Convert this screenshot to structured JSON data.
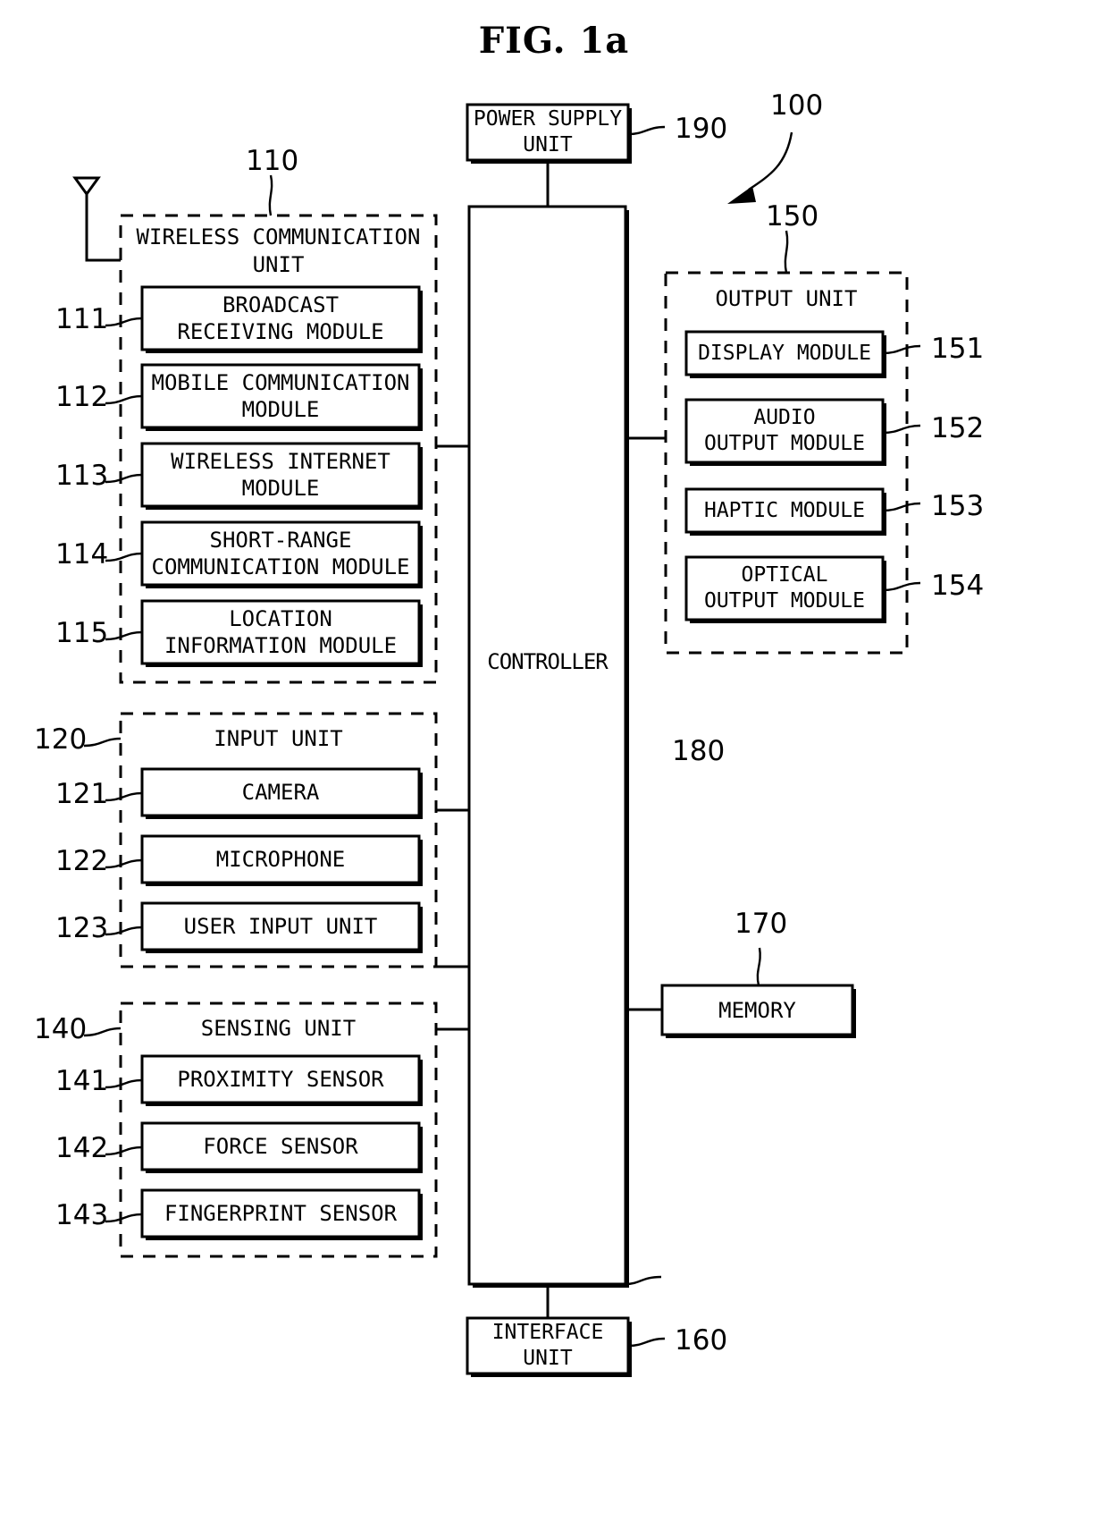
{
  "figure": {
    "title": "FIG. 1a",
    "device_ref": "100"
  },
  "power_supply": {
    "label": "POWER SUPPLY\nUNIT",
    "ref": "190"
  },
  "controller": {
    "label": "CONTROLLER",
    "ref": "180"
  },
  "interface": {
    "label": "INTERFACE\nUNIT",
    "ref": "160"
  },
  "memory": {
    "label": "MEMORY",
    "ref": "170"
  },
  "wireless_unit": {
    "title": "WIRELESS COMMUNICATION\nUNIT",
    "ref": "110",
    "modules": [
      {
        "label": "BROADCAST\nRECEIVING MODULE",
        "ref": "111"
      },
      {
        "label": "MOBILE COMMUNICATION\nMODULE",
        "ref": "112"
      },
      {
        "label": "WIRELESS INTERNET\nMODULE",
        "ref": "113"
      },
      {
        "label": "SHORT-RANGE\nCOMMUNICATION MODULE",
        "ref": "114"
      },
      {
        "label": "LOCATION\nINFORMATION MODULE",
        "ref": "115"
      }
    ]
  },
  "input_unit": {
    "title": "INPUT UNIT",
    "ref": "120",
    "modules": [
      {
        "label": "CAMERA",
        "ref": "121"
      },
      {
        "label": "MICROPHONE",
        "ref": "122"
      },
      {
        "label": "USER INPUT UNIT",
        "ref": "123"
      }
    ]
  },
  "sensing_unit": {
    "title": "SENSING UNIT",
    "ref": "140",
    "modules": [
      {
        "label": "PROXIMITY SENSOR",
        "ref": "141"
      },
      {
        "label": "FORCE SENSOR",
        "ref": "142"
      },
      {
        "label": "FINGERPRINT SENSOR",
        "ref": "143"
      }
    ]
  },
  "output_unit": {
    "title": "OUTPUT UNIT",
    "ref": "150",
    "modules": [
      {
        "label": "DISPLAY MODULE",
        "ref": "151"
      },
      {
        "label": "AUDIO\nOUTPUT MODULE",
        "ref": "152"
      },
      {
        "label": "HAPTIC MODULE",
        "ref": "153"
      },
      {
        "label": "OPTICAL\nOUTPUT MODULE",
        "ref": "154"
      }
    ]
  },
  "icons": {
    "antenna": "antenna-icon",
    "pointer": "arrow-pointer-icon"
  },
  "colors": {
    "ink": "#000000",
    "background": "#ffffff"
  }
}
